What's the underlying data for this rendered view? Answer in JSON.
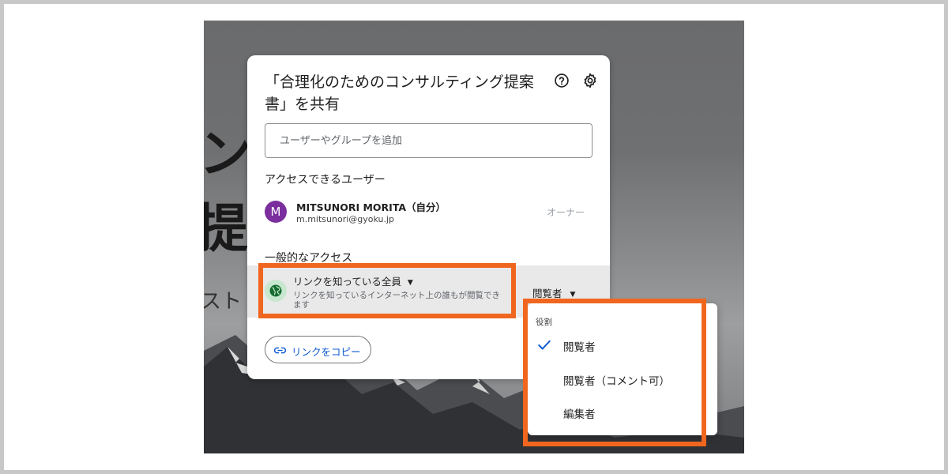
{
  "dialog": {
    "title": "「合理化のためのコンサルティング提案書」を共有",
    "add_placeholder": "ユーザーやグループを追加",
    "access_section_label": "アクセスできるユーザー",
    "user": {
      "avatar_letter": "M",
      "name": "MITSUNORI MORITA（自分）",
      "email": "m.mitsunori@gyoku.jp",
      "role": "オーナー"
    },
    "general_access_label": "一般的なアクセス",
    "link_access": {
      "selected": "リンクを知っている全員",
      "description": "リンクを知っているインターネット上の誰もが閲覧できます",
      "role_selected": "閲覧者"
    },
    "copy_link_label": "リンクをコピー"
  },
  "role_menu": {
    "header": "役割",
    "items": [
      {
        "label": "閲覧者",
        "checked": true
      },
      {
        "label": "閲覧者（コメント可）",
        "checked": false
      },
      {
        "label": "編集者",
        "checked": false
      }
    ]
  },
  "background_text": {
    "line1": "ンフ",
    "line2": "提案",
    "line3": "スト・"
  },
  "colors": {
    "highlight": "#f0661e",
    "avatar": "#7b2f9e",
    "link_blue": "#0b57d0",
    "globe_bg": "#c7e7cf"
  }
}
